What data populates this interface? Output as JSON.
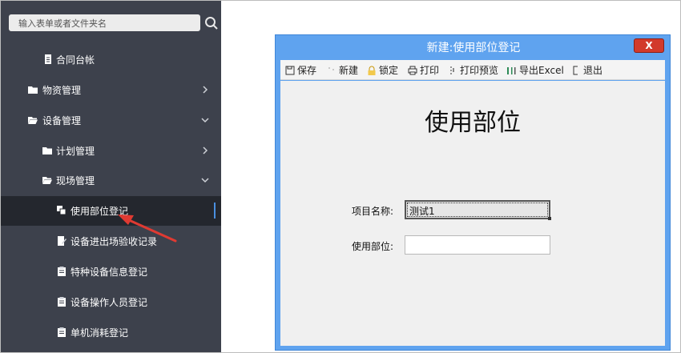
{
  "sidebar": {
    "search_placeholder": "输入表单或者文件夹名",
    "items": [
      {
        "label": "合同台帐",
        "icon": "document-icon"
      },
      {
        "label": "物资管理",
        "icon": "folder-icon",
        "chevron": "right"
      },
      {
        "label": "设备管理",
        "icon": "folder-open-icon",
        "chevron": "down"
      },
      {
        "label": "计划管理",
        "icon": "folder-icon",
        "chevron": "right"
      },
      {
        "label": "现场管理",
        "icon": "folder-open-icon",
        "chevron": "down"
      },
      {
        "label": "使用部位登记",
        "icon": "copy-icon",
        "active": true
      },
      {
        "label": "设备进出场验收记录",
        "icon": "edit-document-icon"
      },
      {
        "label": "特种设备信息登记",
        "icon": "clipboard-icon"
      },
      {
        "label": "设备操作人员登记",
        "icon": "clipboard-icon"
      },
      {
        "label": "单机消耗登记",
        "icon": "clipboard-icon"
      }
    ]
  },
  "dialog": {
    "title": "新建:使用部位登记",
    "close_label": "X",
    "toolbar": [
      {
        "label": "保存",
        "icon": "save-icon"
      },
      {
        "label": "新建",
        "icon": "new-icon"
      },
      {
        "label": "锁定",
        "icon": "lock-icon"
      },
      {
        "label": "打印",
        "icon": "print-icon"
      },
      {
        "label": "打印预览",
        "icon": "print-preview-icon"
      },
      {
        "label": "导出Excel",
        "icon": "excel-icon"
      },
      {
        "label": "退出",
        "icon": "exit-icon"
      }
    ],
    "form": {
      "heading": "使用部位",
      "project_name_label": "项目名称:",
      "project_name_value": "测试1",
      "usage_location_label": "使用部位:",
      "usage_location_value": ""
    }
  },
  "colors": {
    "sidebar_bg": "#3d414c",
    "active_item_bg": "#24272e",
    "dialog_border": "#5fa3ef",
    "close_button": "#d23a2c",
    "annotation_arrow": "#e03a32"
  }
}
